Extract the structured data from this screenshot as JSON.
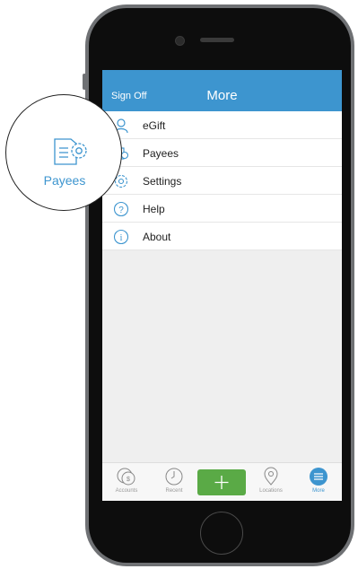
{
  "header": {
    "sign_off": "Sign Off",
    "title": "More"
  },
  "menu": {
    "items": [
      {
        "label": "eGift",
        "icon": "person-icon"
      },
      {
        "label": "Payees",
        "icon": "payees-icon"
      },
      {
        "label": "Settings",
        "icon": "gear-icon"
      },
      {
        "label": "Help",
        "icon": "help-icon"
      },
      {
        "label": "About",
        "icon": "info-icon"
      }
    ]
  },
  "tabbar": {
    "tabs": [
      {
        "label": "Accounts",
        "icon": "accounts-icon"
      },
      {
        "label": "Recent",
        "icon": "clock-icon"
      },
      {
        "label": "",
        "icon": "plus-icon"
      },
      {
        "label": "Locations",
        "icon": "location-pin-icon"
      },
      {
        "label": "More",
        "icon": "more-menu-icon",
        "active": true
      }
    ]
  },
  "callout": {
    "label": "Payees",
    "icon": "payees-icon"
  },
  "colors": {
    "accent": "#3d95cf",
    "add_button": "#5aaa46",
    "phone_frame": "#6f7174"
  }
}
